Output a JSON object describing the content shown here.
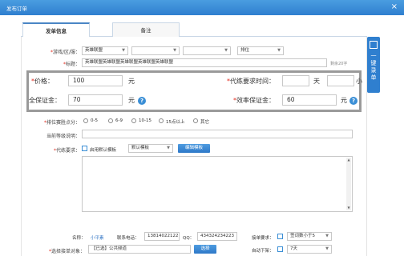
{
  "window": {
    "title": "发布订单",
    "close_glyph": "×"
  },
  "tabs": [
    {
      "label": "发单信息"
    },
    {
      "label": "备注"
    }
  ],
  "form": {
    "region_label": "游戏/区/服：",
    "region_value": "英雄联盟",
    "arrow": "▼",
    "position_value": "排位",
    "title_label": "标题：",
    "title_value": "英雄联盟英雄联盟英雄联盟英雄联盟英雄联盟",
    "title_hint": "剩余20字",
    "price_label": "价格：",
    "price_value": "100",
    "price_unit": "元",
    "time_label": "代练要求时间：",
    "time_unit_day": "天",
    "time_unit_hour": "小",
    "safety_label": "全保证金：",
    "safety_value": "70",
    "safety_unit": "元",
    "efficiency_label": "效率保证金：",
    "efficiency_value": "60",
    "efficiency_unit": "元",
    "help_glyph": "?",
    "position_points_label": "排位赛胜点分：",
    "points_options": [
      "0-5",
      "6-9",
      "10-15",
      "15点以上",
      "其它"
    ],
    "current_rank_label": "当前等级说明：",
    "requirement_label": "代练要求：",
    "template_check_label": "启用默认模板",
    "template_select": "默认模板",
    "edit_template_button": "编辑模板",
    "scroll_up": "▲",
    "scroll_down": "▼"
  },
  "bottom": {
    "name_label": "名称：",
    "name_value": "小平素",
    "phone_label": "联系电话：",
    "phone_value": "13814022122",
    "qq_label": "QQ：",
    "qq_value": "434324234223",
    "accept_req_label": "接单要求：",
    "accept_req_value": "签词数小于5",
    "select_target_label": "选择接单对象：",
    "select_target_value": "【已选】公共频道",
    "select_button": "选择",
    "auto_offline_label": "自动下架：",
    "auto_offline_value": "7天"
  },
  "side_button": {
    "label": "一键录单"
  }
}
